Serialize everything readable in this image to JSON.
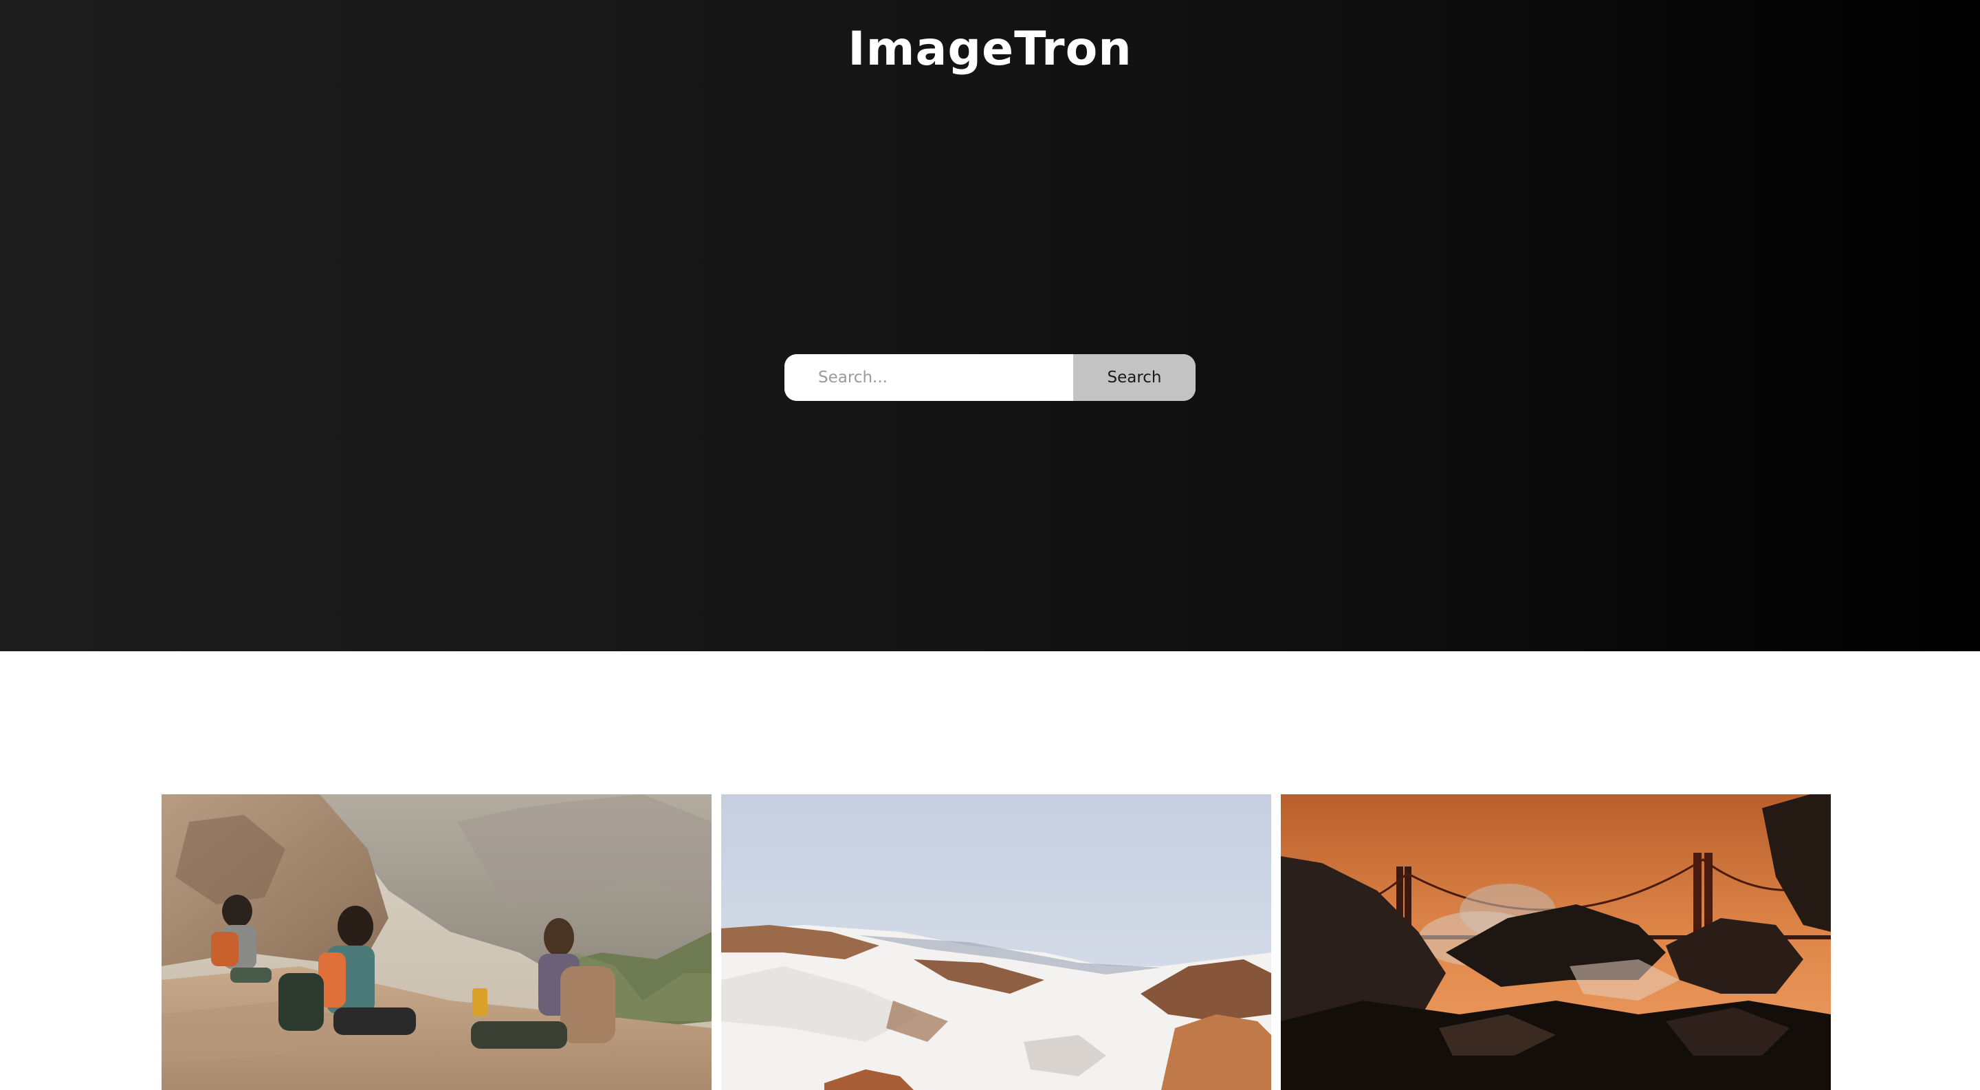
{
  "header": {
    "brand": "ImageTron"
  },
  "search": {
    "placeholder": "Search...",
    "button_label": "Search"
  },
  "gallery": {
    "images": [
      {
        "name": "hikers-canyon-photo"
      },
      {
        "name": "snowy-mountain-photo"
      },
      {
        "name": "golden-gate-sunset-photo"
      }
    ]
  },
  "colors": {
    "hero_dark_left": "#1c1c1c",
    "hero_dark_right": "#000000",
    "search_button_bg": "#c3c3c3"
  }
}
